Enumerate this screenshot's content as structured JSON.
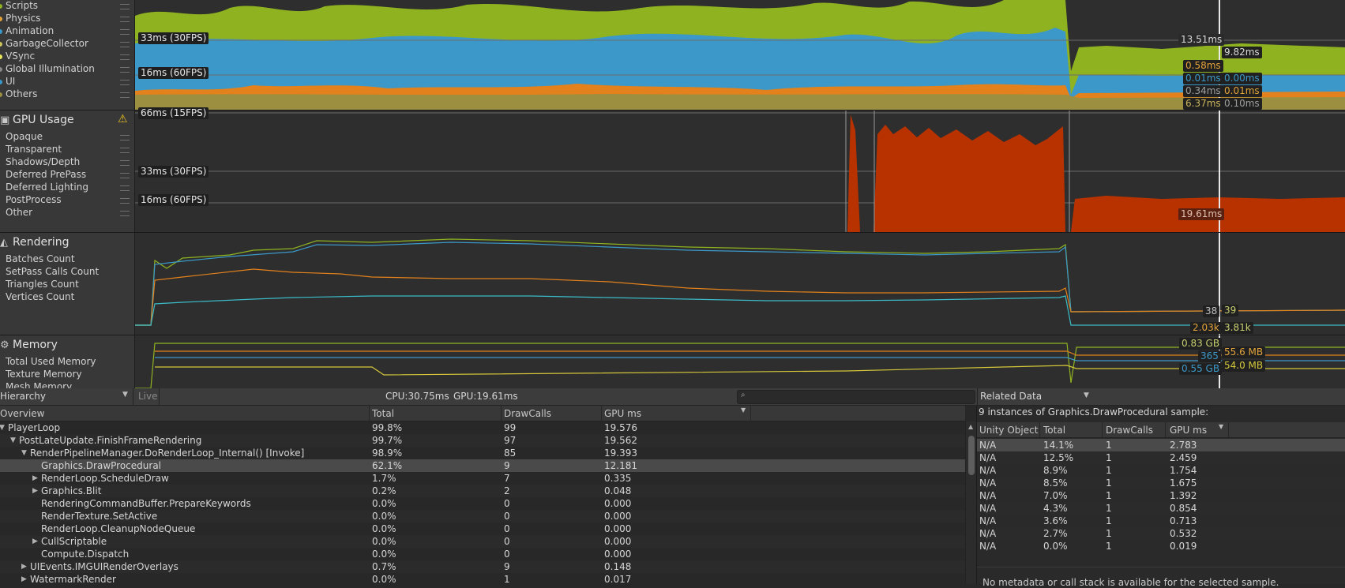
{
  "cpu_section": {
    "items": [
      "Scripts",
      "Physics",
      "Animation",
      "GarbageCollector",
      "VSync",
      "Global Illumination",
      "UI",
      "Others"
    ],
    "fps_marks": [
      "33ms (30FPS)",
      "16ms (60FPS)"
    ],
    "values_left": [
      "13.51ms",
      "0.58ms",
      "0.01ms",
      "0.34ms",
      "6.37ms"
    ],
    "values_right": [
      "9.82ms",
      "0.00ms",
      "0.01ms",
      "0.10ms"
    ],
    "colors": {
      "scripts": "#8fb320",
      "render": "#3b98c8",
      "orange": "#e3811c",
      "others": "#9c8f3f"
    }
  },
  "gpu_section": {
    "title": "GPU Usage",
    "items": [
      "Opaque",
      "Transparent",
      "Shadows/Depth",
      "Deferred PrePass",
      "Deferred Lighting",
      "PostProcess",
      "Other"
    ],
    "fps_marks": [
      "66ms (15FPS)",
      "33ms (30FPS)",
      "16ms (60FPS)"
    ],
    "value": "19.61ms",
    "warning_icon": "warning-icon",
    "color": "#b83200"
  },
  "rendering_section": {
    "title": "Rendering",
    "items": [
      "Batches Count",
      "SetPass Calls Count",
      "Triangles Count",
      "Vertices Count"
    ],
    "values_left": [
      "38",
      "2.03k"
    ],
    "values_right": [
      "39",
      "3.81k"
    ]
  },
  "memory_section": {
    "title": "Memory",
    "items": [
      "Total Used Memory",
      "Texture Memory",
      "Mesh Memory"
    ],
    "values_left": [
      "0.83 GB",
      "365",
      "0.55 GB"
    ],
    "values_right": [
      "55.6 MB",
      "54.0 MB"
    ]
  },
  "toolbar": {
    "view_select": "Hierarchy",
    "live_label": "Live",
    "cpu": "CPU:30.75ms",
    "gpu": "GPU:19.61ms",
    "search_placeholder": "",
    "related_select": "Related Data"
  },
  "hierarchy": {
    "columns": [
      "Overview",
      "Total",
      "DrawCalls",
      "GPU ms"
    ],
    "rows": [
      {
        "name": "PlayerLoop",
        "total": "99.8%",
        "draw": "99",
        "gpu": "19.576",
        "depth": 0,
        "arrow": "▼"
      },
      {
        "name": "PostLateUpdate.FinishFrameRendering",
        "total": "99.7%",
        "draw": "97",
        "gpu": "19.562",
        "depth": 1,
        "arrow": "▼"
      },
      {
        "name": "RenderPipelineManager.DoRenderLoop_Internal() [Invoke]",
        "total": "98.9%",
        "draw": "85",
        "gpu": "19.393",
        "depth": 2,
        "arrow": "▼"
      },
      {
        "name": "Graphics.DrawProcedural",
        "total": "62.1%",
        "draw": "9",
        "gpu": "12.181",
        "depth": 3,
        "arrow": ""
      },
      {
        "name": "RenderLoop.ScheduleDraw",
        "total": "1.7%",
        "draw": "7",
        "gpu": "0.335",
        "depth": 3,
        "arrow": "▶"
      },
      {
        "name": "Graphics.Blit",
        "total": "0.2%",
        "draw": "2",
        "gpu": "0.048",
        "depth": 3,
        "arrow": "▶"
      },
      {
        "name": "RenderingCommandBuffer.PrepareKeywords",
        "total": "0.0%",
        "draw": "0",
        "gpu": "0.000",
        "depth": 3,
        "arrow": ""
      },
      {
        "name": "RenderTexture.SetActive",
        "total": "0.0%",
        "draw": "0",
        "gpu": "0.000",
        "depth": 3,
        "arrow": ""
      },
      {
        "name": "RenderLoop.CleanupNodeQueue",
        "total": "0.0%",
        "draw": "0",
        "gpu": "0.000",
        "depth": 3,
        "arrow": ""
      },
      {
        "name": "CullScriptable",
        "total": "0.0%",
        "draw": "0",
        "gpu": "0.000",
        "depth": 3,
        "arrow": "▶"
      },
      {
        "name": "Compute.Dispatch",
        "total": "0.0%",
        "draw": "0",
        "gpu": "0.000",
        "depth": 3,
        "arrow": ""
      },
      {
        "name": "UIEvents.IMGUIRenderOverlays",
        "total": "0.7%",
        "draw": "9",
        "gpu": "0.148",
        "depth": 2,
        "arrow": "▶"
      },
      {
        "name": "WatermarkRender",
        "total": "0.0%",
        "draw": "1",
        "gpu": "0.017",
        "depth": 2,
        "arrow": "▶"
      }
    ]
  },
  "related": {
    "summary": "9 instances of Graphics.DrawProcedural sample:",
    "columns": [
      "Unity Object",
      "Total",
      "DrawCalls",
      "GPU ms"
    ],
    "rows": [
      {
        "obj": "N/A",
        "total": "14.1%",
        "draw": "1",
        "gpu": "2.783"
      },
      {
        "obj": "N/A",
        "total": "12.5%",
        "draw": "1",
        "gpu": "2.459"
      },
      {
        "obj": "N/A",
        "total": "8.9%",
        "draw": "1",
        "gpu": "1.754"
      },
      {
        "obj": "N/A",
        "total": "8.5%",
        "draw": "1",
        "gpu": "1.675"
      },
      {
        "obj": "N/A",
        "total": "7.0%",
        "draw": "1",
        "gpu": "1.392"
      },
      {
        "obj": "N/A",
        "total": "4.3%",
        "draw": "1",
        "gpu": "0.854"
      },
      {
        "obj": "N/A",
        "total": "3.6%",
        "draw": "1",
        "gpu": "0.713"
      },
      {
        "obj": "N/A",
        "total": "2.7%",
        "draw": "1",
        "gpu": "0.532"
      },
      {
        "obj": "N/A",
        "total": "0.0%",
        "draw": "1",
        "gpu": "0.019"
      }
    ],
    "footer": "No metadata or call stack is available for the selected sample."
  }
}
